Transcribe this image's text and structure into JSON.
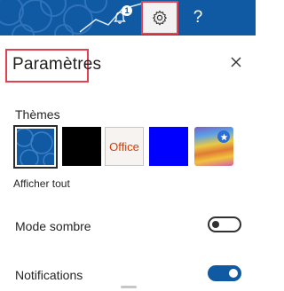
{
  "topbar": {
    "notification_count": "1",
    "help_label": "?",
    "icons": [
      "bell-icon",
      "gear-icon",
      "help-icon"
    ],
    "color": "#0f5aa3"
  },
  "panel": {
    "title": "Paramètres",
    "close_icon": "close-icon"
  },
  "themes": {
    "label": "Thèmes",
    "items": [
      {
        "name": "blue-pattern",
        "selected": true
      },
      {
        "name": "black"
      },
      {
        "name": "office",
        "label": "Office"
      },
      {
        "name": "blue"
      },
      {
        "name": "colorful-premium",
        "icon": "star-icon"
      }
    ],
    "show_all": "Afficher tout"
  },
  "settings": {
    "dark_mode": {
      "label": "Mode sombre",
      "on": false
    },
    "notifications": {
      "label": "Notifications",
      "on": true
    }
  },
  "accent_color": "#e0424f"
}
